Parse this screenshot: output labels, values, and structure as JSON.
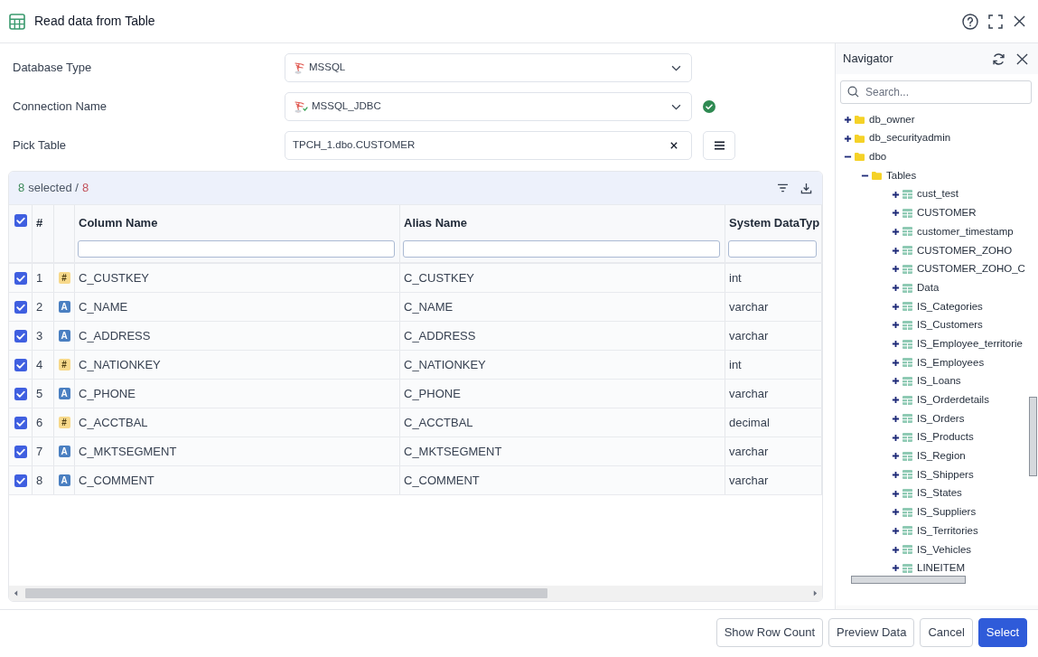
{
  "window": {
    "title": "Read data from Table"
  },
  "form": [
    {
      "kind": "select",
      "label": "Database Type",
      "value": "MSSQL",
      "verified": false
    },
    {
      "kind": "select",
      "label": "Connection Name",
      "value": "MSSQL_JDBC",
      "verified": true
    },
    {
      "kind": "picker",
      "label": "Pick Table",
      "value": "TPCH_1.dbo.CUSTOMER",
      "verified": false
    }
  ],
  "grid": {
    "selected_count": "8",
    "selected_label": "selected /",
    "total_count": "8",
    "all_checked": true,
    "columns": [
      {
        "label": "#",
        "filter": false
      },
      {
        "label": "Column Name",
        "filter": true
      },
      {
        "label": "Alias Name",
        "filter": true
      },
      {
        "label": "System DataTyp",
        "filter": true
      }
    ],
    "rows": [
      {
        "checked": true,
        "number": "1",
        "kind": "numeric",
        "type_symbol": "#",
        "column_name": "C_CUSTKEY",
        "alias_name": "C_CUSTKEY",
        "system_datatype": "int"
      },
      {
        "checked": true,
        "number": "2",
        "kind": "text",
        "type_symbol": "A",
        "column_name": "C_NAME",
        "alias_name": "C_NAME",
        "system_datatype": "varchar"
      },
      {
        "checked": true,
        "number": "3",
        "kind": "text",
        "type_symbol": "A",
        "column_name": "C_ADDRESS",
        "alias_name": "C_ADDRESS",
        "system_datatype": "varchar"
      },
      {
        "checked": true,
        "number": "4",
        "kind": "numeric",
        "type_symbol": "#",
        "column_name": "C_NATIONKEY",
        "alias_name": "C_NATIONKEY",
        "system_datatype": "int"
      },
      {
        "checked": true,
        "number": "5",
        "kind": "text",
        "type_symbol": "A",
        "column_name": "C_PHONE",
        "alias_name": "C_PHONE",
        "system_datatype": "varchar"
      },
      {
        "checked": true,
        "number": "6",
        "kind": "numeric",
        "type_symbol": "#",
        "column_name": "C_ACCTBAL",
        "alias_name": "C_ACCTBAL",
        "system_datatype": "decimal"
      },
      {
        "checked": true,
        "number": "7",
        "kind": "text",
        "type_symbol": "A",
        "column_name": "C_MKTSEGMENT",
        "alias_name": "C_MKTSEGMENT",
        "system_datatype": "varchar"
      },
      {
        "checked": true,
        "number": "8",
        "kind": "text",
        "type_symbol": "A",
        "column_name": "C_COMMENT",
        "alias_name": "C_COMMENT",
        "system_datatype": "varchar"
      }
    ]
  },
  "navigator": {
    "title": "Navigator",
    "search": {
      "placeholder": "Search..."
    },
    "tree": [
      {
        "label": "db_owner",
        "kind": "folder",
        "expanded": false
      },
      {
        "label": "db_securityadmin",
        "kind": "folder",
        "expanded": false
      },
      {
        "label": "dbo",
        "kind": "folder",
        "expanded": true,
        "children": [
          {
            "label": "Tables",
            "kind": "folder",
            "expanded": true,
            "children": [
              {
                "label": "cust_test",
                "kind": "table",
                "expanded": false
              },
              {
                "label": "CUSTOMER",
                "kind": "table",
                "expanded": false
              },
              {
                "label": "customer_timestamp",
                "kind": "table",
                "expanded": false
              },
              {
                "label": "CUSTOMER_ZOHO",
                "kind": "table",
                "expanded": false
              },
              {
                "label": "CUSTOMER_ZOHO_C",
                "kind": "table",
                "expanded": false
              },
              {
                "label": "Data",
                "kind": "table",
                "expanded": false
              },
              {
                "label": "IS_Categories",
                "kind": "table",
                "expanded": false
              },
              {
                "label": "IS_Customers",
                "kind": "table",
                "expanded": false
              },
              {
                "label": "IS_Employee_territorie",
                "kind": "table",
                "expanded": false
              },
              {
                "label": "IS_Employees",
                "kind": "table",
                "expanded": false
              },
              {
                "label": "IS_Loans",
                "kind": "table",
                "expanded": false
              },
              {
                "label": "IS_Orderdetails",
                "kind": "table",
                "expanded": false
              },
              {
                "label": "IS_Orders",
                "kind": "table",
                "expanded": false
              },
              {
                "label": "IS_Products",
                "kind": "table",
                "expanded": false
              },
              {
                "label": "IS_Region",
                "kind": "table",
                "expanded": false
              },
              {
                "label": "IS_Shippers",
                "kind": "table",
                "expanded": false
              },
              {
                "label": "IS_States",
                "kind": "table",
                "expanded": false
              },
              {
                "label": "IS_Suppliers",
                "kind": "table",
                "expanded": false
              },
              {
                "label": "IS_Territories",
                "kind": "table",
                "expanded": false
              },
              {
                "label": "IS_Vehicles",
                "kind": "table",
                "expanded": false
              },
              {
                "label": "LINEITEM",
                "kind": "table",
                "expanded": false
              }
            ]
          }
        ]
      }
    ]
  },
  "buttons": [
    {
      "label": "Show Row Count",
      "kind": "secondary"
    },
    {
      "label": "Preview Data",
      "kind": "secondary"
    },
    {
      "label": "Cancel",
      "kind": "secondary"
    },
    {
      "label": "Select",
      "kind": "primary"
    }
  ]
}
